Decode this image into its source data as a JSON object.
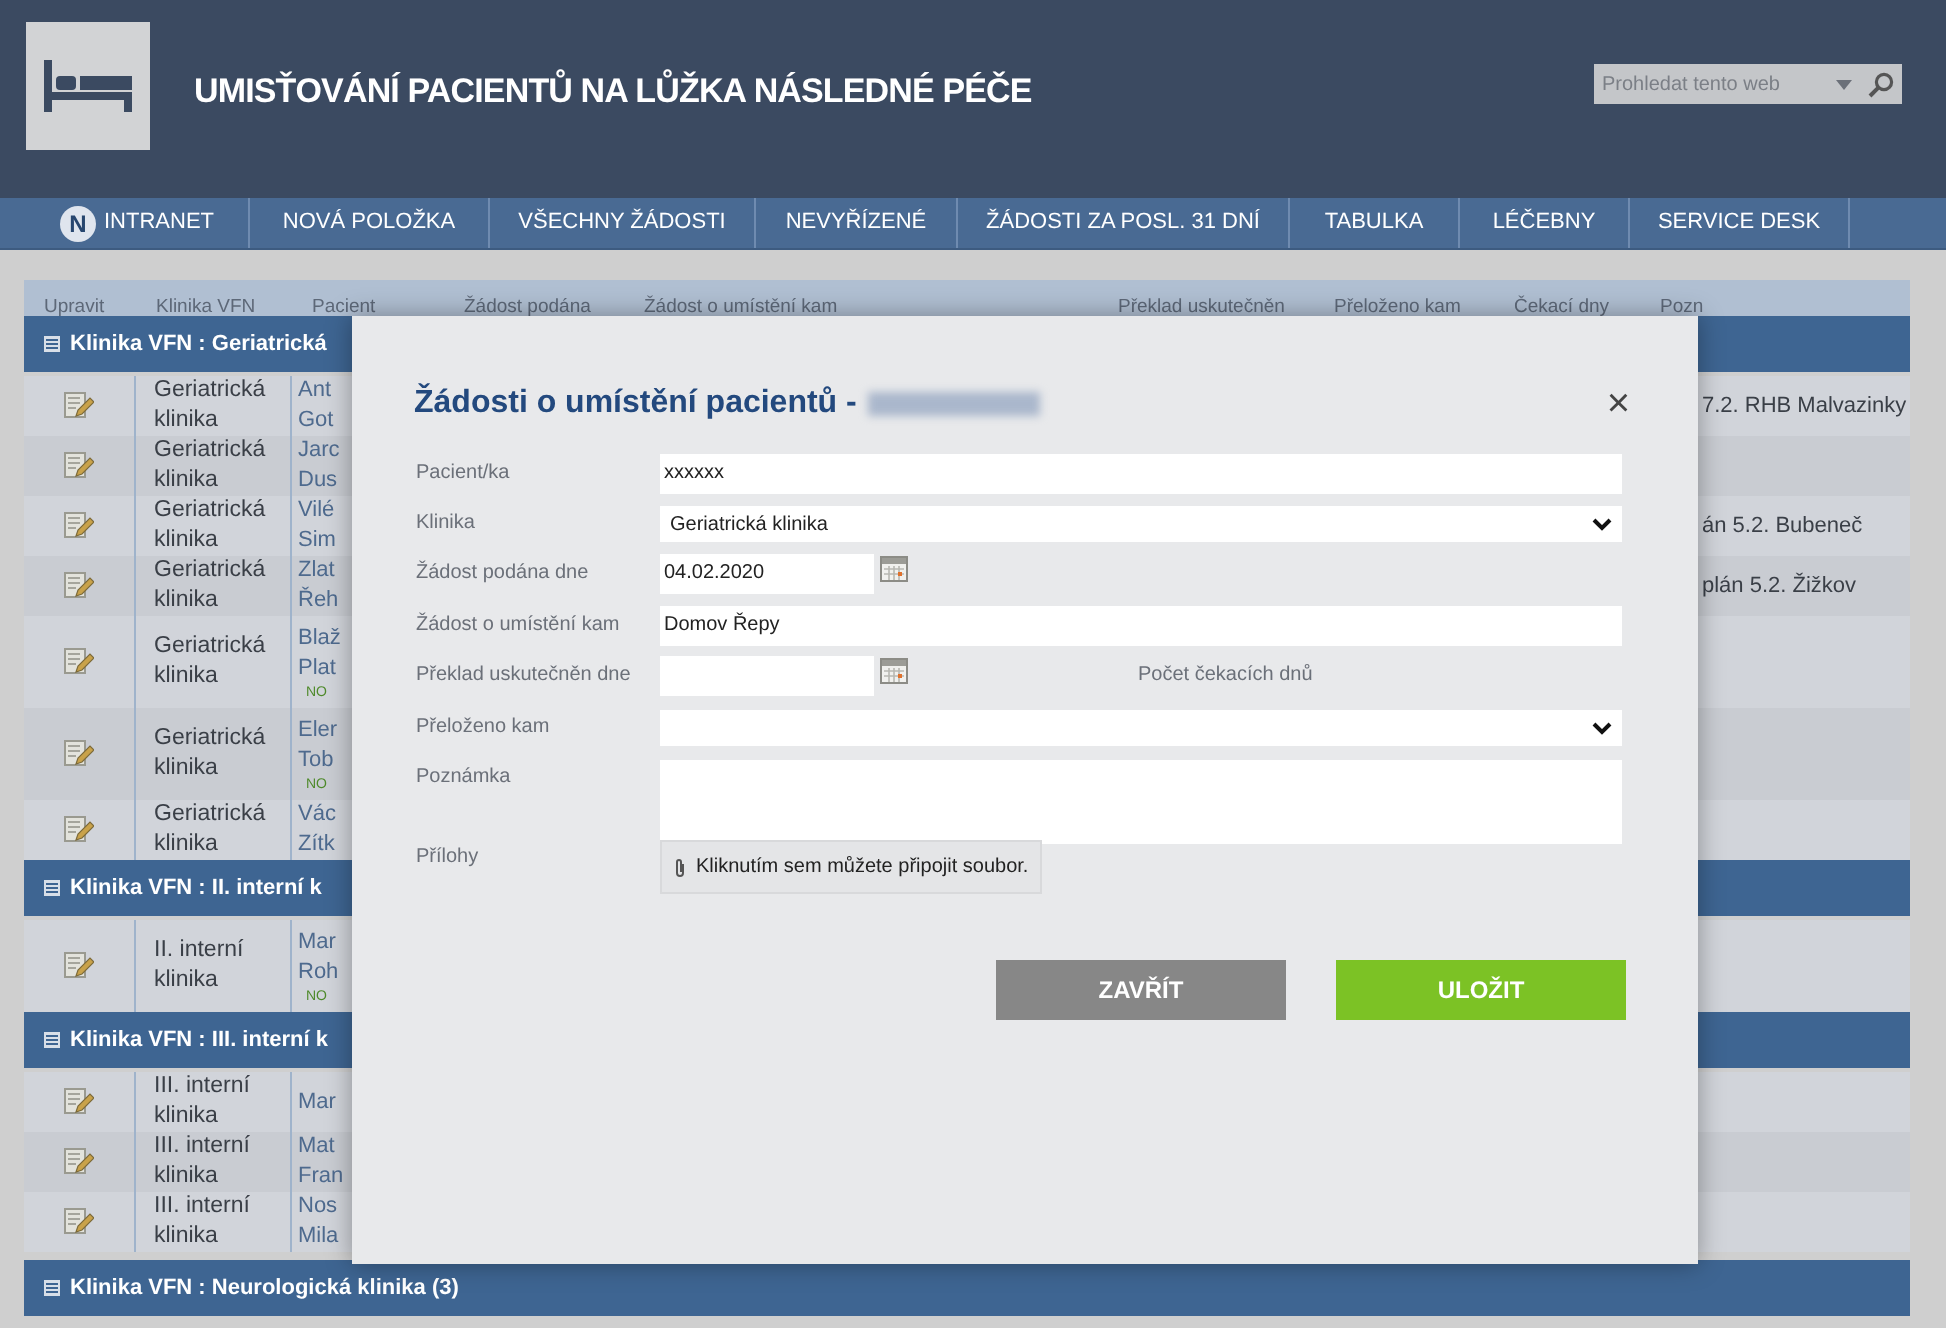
{
  "header": {
    "title": "UMISŤOVÁNÍ PACIENTŮ NA LŮŽKA NÁSLEDNÉ PÉČE",
    "search": {
      "placeholder": "Prohledat tento web"
    }
  },
  "nav": [
    {
      "label": "INTRANET",
      "icon_text": "N"
    },
    {
      "label": "NOVÁ POLOŽKA"
    },
    {
      "label": "VŠECHNY ŽÁDOSTI"
    },
    {
      "label": "NEVYŘÍZENÉ"
    },
    {
      "label": "ŽÁDOSTI ZA POSL. 31 DNÍ"
    },
    {
      "label": "TABULKA"
    },
    {
      "label": "LÉČEBNY"
    },
    {
      "label": "SERVICE DESK"
    }
  ],
  "table": {
    "columns": [
      "Upravit",
      "Klinika VFN",
      "Pacient",
      "Žádost podána",
      "Žádost o umístění kam",
      "Překlad uskutečněn",
      "Přeloženo kam",
      "Čekací dny",
      "Pozn"
    ],
    "groups": [
      {
        "title": "Klinika VFN : Geriatrická",
        "rows": [
          {
            "clinic": "Geriatrická klinika",
            "patient": [
              "Ant",
              "Got"
            ],
            "note": "7.2. RHB Malvazinky"
          },
          {
            "clinic": "Geriatrická klinika",
            "patient": [
              "Jarc",
              "Dus"
            ]
          },
          {
            "clinic": "Geriatrická klinika",
            "patient": [
              "Vilé",
              "Sim"
            ],
            "note": "án 5.2. Bubeneč"
          },
          {
            "clinic": "Geriatrická klinika",
            "patient": [
              "Zlat",
              "Řeh"
            ],
            "note": "plán 5.2. Žižkov"
          },
          {
            "clinic": "Geriatrická klinika",
            "patient": [
              "Blaž",
              "Plat"
            ],
            "badge": "NO"
          },
          {
            "clinic": "Geriatrická klinika",
            "patient": [
              "Eler",
              "Tob"
            ],
            "badge": "NO"
          },
          {
            "clinic": "Geriatrická klinika",
            "patient": [
              "Vác",
              "Zítk"
            ]
          }
        ]
      },
      {
        "title": "Klinika VFN : II. interní k",
        "rows": [
          {
            "clinic": "II. interní klinika",
            "patient": [
              "Mar",
              "Roh"
            ],
            "badge": "NO"
          }
        ]
      },
      {
        "title": "Klinika VFN : III. interní k",
        "rows": [
          {
            "clinic": "III. interní klinika",
            "patient": [
              "Mar"
            ]
          },
          {
            "clinic": "III. interní klinika",
            "patient": [
              "Mat",
              "Fran"
            ]
          },
          {
            "clinic": "III. interní klinika",
            "patient": [
              "Nos",
              "Mila"
            ]
          }
        ]
      },
      {
        "title": "Klinika VFN : Neurologická klinika",
        "count": "(3)"
      }
    ]
  },
  "dialog": {
    "title": "Žádosti o umístění pacientů -",
    "close": "×",
    "fields": [
      {
        "label": "Pacient/ka",
        "kind": "text",
        "value": "xxxxxx"
      },
      {
        "label": "Klinika",
        "kind": "select",
        "value": "Geriatrická klinika"
      },
      {
        "label": "Žádost podána dne",
        "kind": "date",
        "value": "04.02.2020"
      },
      {
        "label": "Žádost o umístění kam",
        "kind": "text",
        "value": "Domov Řepy"
      },
      {
        "label": "Překlad uskutečněn dne",
        "kind": "date",
        "side_label": "Počet čekacích dnů"
      },
      {
        "label": "Přeloženo kam",
        "kind": "select"
      },
      {
        "label": "Poznámka",
        "kind": "textarea"
      },
      {
        "label": "Přílohy",
        "kind": "attachment",
        "value": "Kliknutím sem můžete připojit soubor."
      }
    ],
    "buttons": [
      {
        "label": "ZAVŘÍT",
        "kind": "secondary"
      },
      {
        "label": "ULOŽIT",
        "kind": "primary"
      }
    ]
  }
}
